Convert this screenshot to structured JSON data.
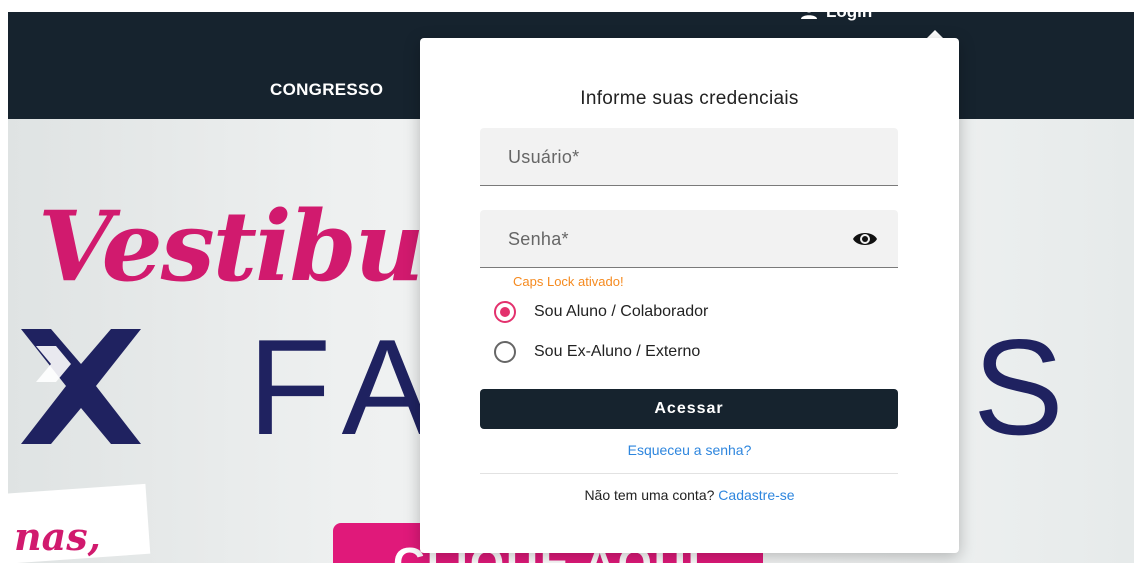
{
  "header": {
    "nav_item": "CONGRESSO",
    "login_label": "Login",
    "login_icon": "user-icon"
  },
  "hero": {
    "script_word": "Vestibul",
    "brand_left": "FA",
    "brand_right": "S",
    "slogan_fragment": "nas,",
    "cta_text": "CLIQUE AQUI",
    "colors": {
      "script": "#d11a6e",
      "brand": "#1f2260",
      "cta": "#e0197a"
    }
  },
  "login_popup": {
    "title": "Informe suas credenciais",
    "username_label": "Usuário*",
    "password_label": "Senha*",
    "password_visibility_icon": "eye-icon",
    "caps_lock_warning": "Caps Lock ativado!",
    "user_types": [
      {
        "label": "Sou Aluno / Colaborador",
        "selected": true
      },
      {
        "label": "Sou Ex-Aluno / Externo",
        "selected": false
      }
    ],
    "submit_label": "Acessar",
    "forgot_password": "Esqueceu a senha?",
    "signup_prompt": "Não tem uma conta?",
    "signup_link": "Cadastre-se"
  },
  "colors": {
    "header_bg": "#16232e",
    "accent": "#e3316d",
    "link": "#2e86de",
    "warning": "#f58a1f"
  }
}
